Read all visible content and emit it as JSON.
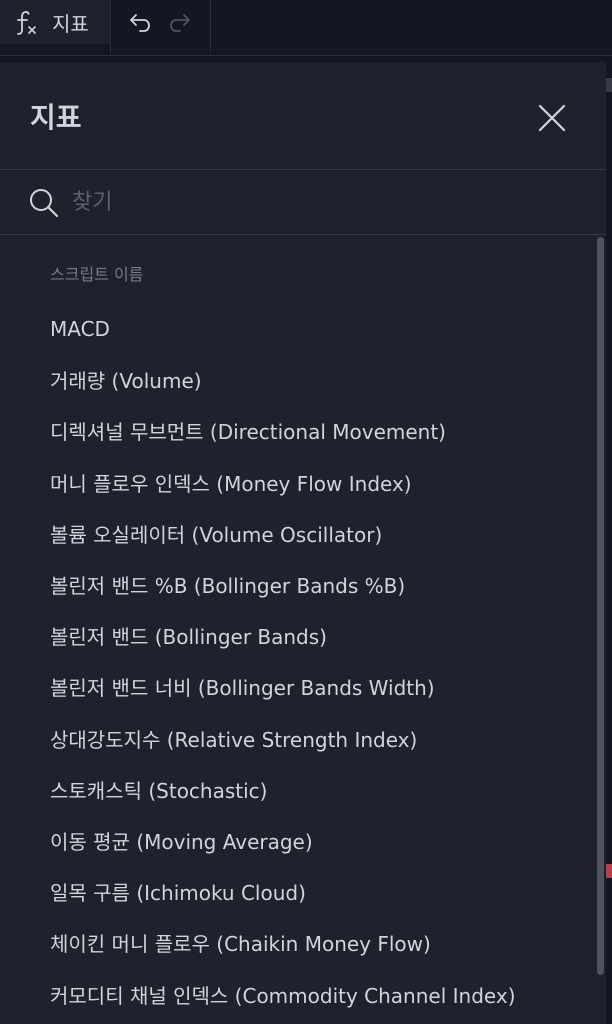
{
  "toolbar": {
    "indicators_label": "지표",
    "icons": [
      "fx-icon",
      "undo-icon",
      "redo-icon"
    ]
  },
  "dialog": {
    "title": "지표",
    "close_icon": "close-icon",
    "search": {
      "placeholder": "찾기",
      "value": "",
      "icon": "search-icon"
    },
    "section_label": "스크립트 이름",
    "items": [
      "MACD",
      "거래량 (Volume)",
      "디렉셔널 무브먼트 (Directional Movement)",
      "머니 플로우 인덱스 (Money Flow Index)",
      "볼륨 오실레이터 (Volume Oscillator)",
      "볼린저 밴드 %B (Bollinger Bands %B)",
      "볼린저 밴드 (Bollinger Bands)",
      "볼린저 밴드 너비 (Bollinger Bands Width)",
      "상대강도지수 (Relative Strength Index)",
      "스토캐스틱 (Stochastic)",
      "이동 평균 (Moving Average)",
      "일목 구름 (Ichimoku Cloud)",
      "체이킨 머니 플로우 (Chaikin Money Flow)",
      "커모디티 채널 인덱스 (Commodity Channel Index)"
    ]
  },
  "colors": {
    "background": "#131722",
    "panel": "#1e222d",
    "text": "#d1d4dc",
    "muted_text": "#787b86",
    "divider": "#363a45"
  }
}
